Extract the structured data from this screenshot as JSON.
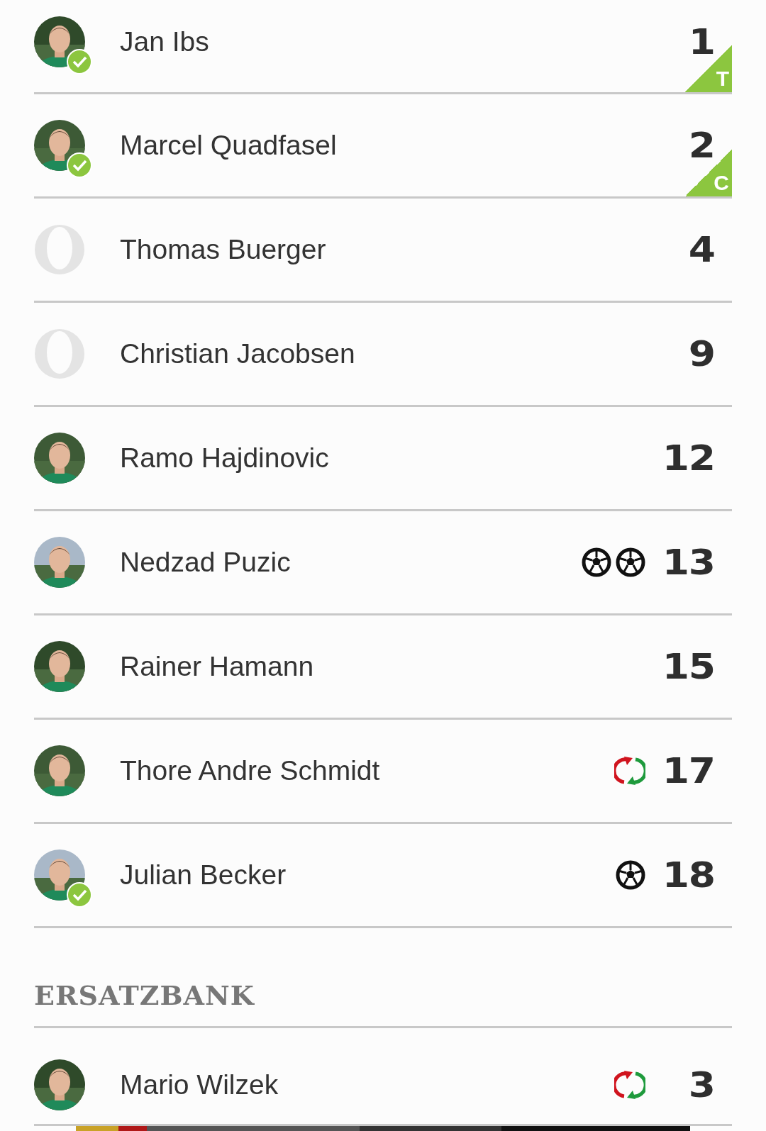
{
  "lineup": [
    {
      "name": "Jan Ibs",
      "number": "1",
      "verified": true,
      "badge": "T"
    },
    {
      "name": "Marcel Quadfasel",
      "number": "2",
      "verified": true,
      "badge": "C"
    },
    {
      "name": "Thomas Buerger",
      "number": "4",
      "kind": "placeholder",
      "verified": false
    },
    {
      "name": "Christian Jacobsen",
      "number": "9",
      "kind": "placeholder",
      "verified": false
    },
    {
      "name": "Ramo Hajdinovic",
      "number": "12",
      "verified": false
    },
    {
      "name": "Nedzad Puzic",
      "number": "13",
      "verified": false,
      "events": [
        {
          "kind": "goal"
        },
        {
          "kind": "goal"
        }
      ]
    },
    {
      "name": "Rainer Hamann",
      "number": "15",
      "verified": false
    },
    {
      "name": "Thore Andre Schmidt",
      "number": "17",
      "verified": false,
      "events": [
        {
          "kind": "substitution"
        }
      ]
    },
    {
      "name": "Julian Becker",
      "number": "18",
      "verified": true,
      "events": [
        {
          "kind": "goal"
        }
      ]
    }
  ],
  "bench": {
    "title": "ERSATZBANK",
    "players": [
      {
        "name": "Mario Wilzek",
        "number": "3",
        "verified": false,
        "events": [
          {
            "kind": "substitution"
          }
        ]
      }
    ]
  }
}
